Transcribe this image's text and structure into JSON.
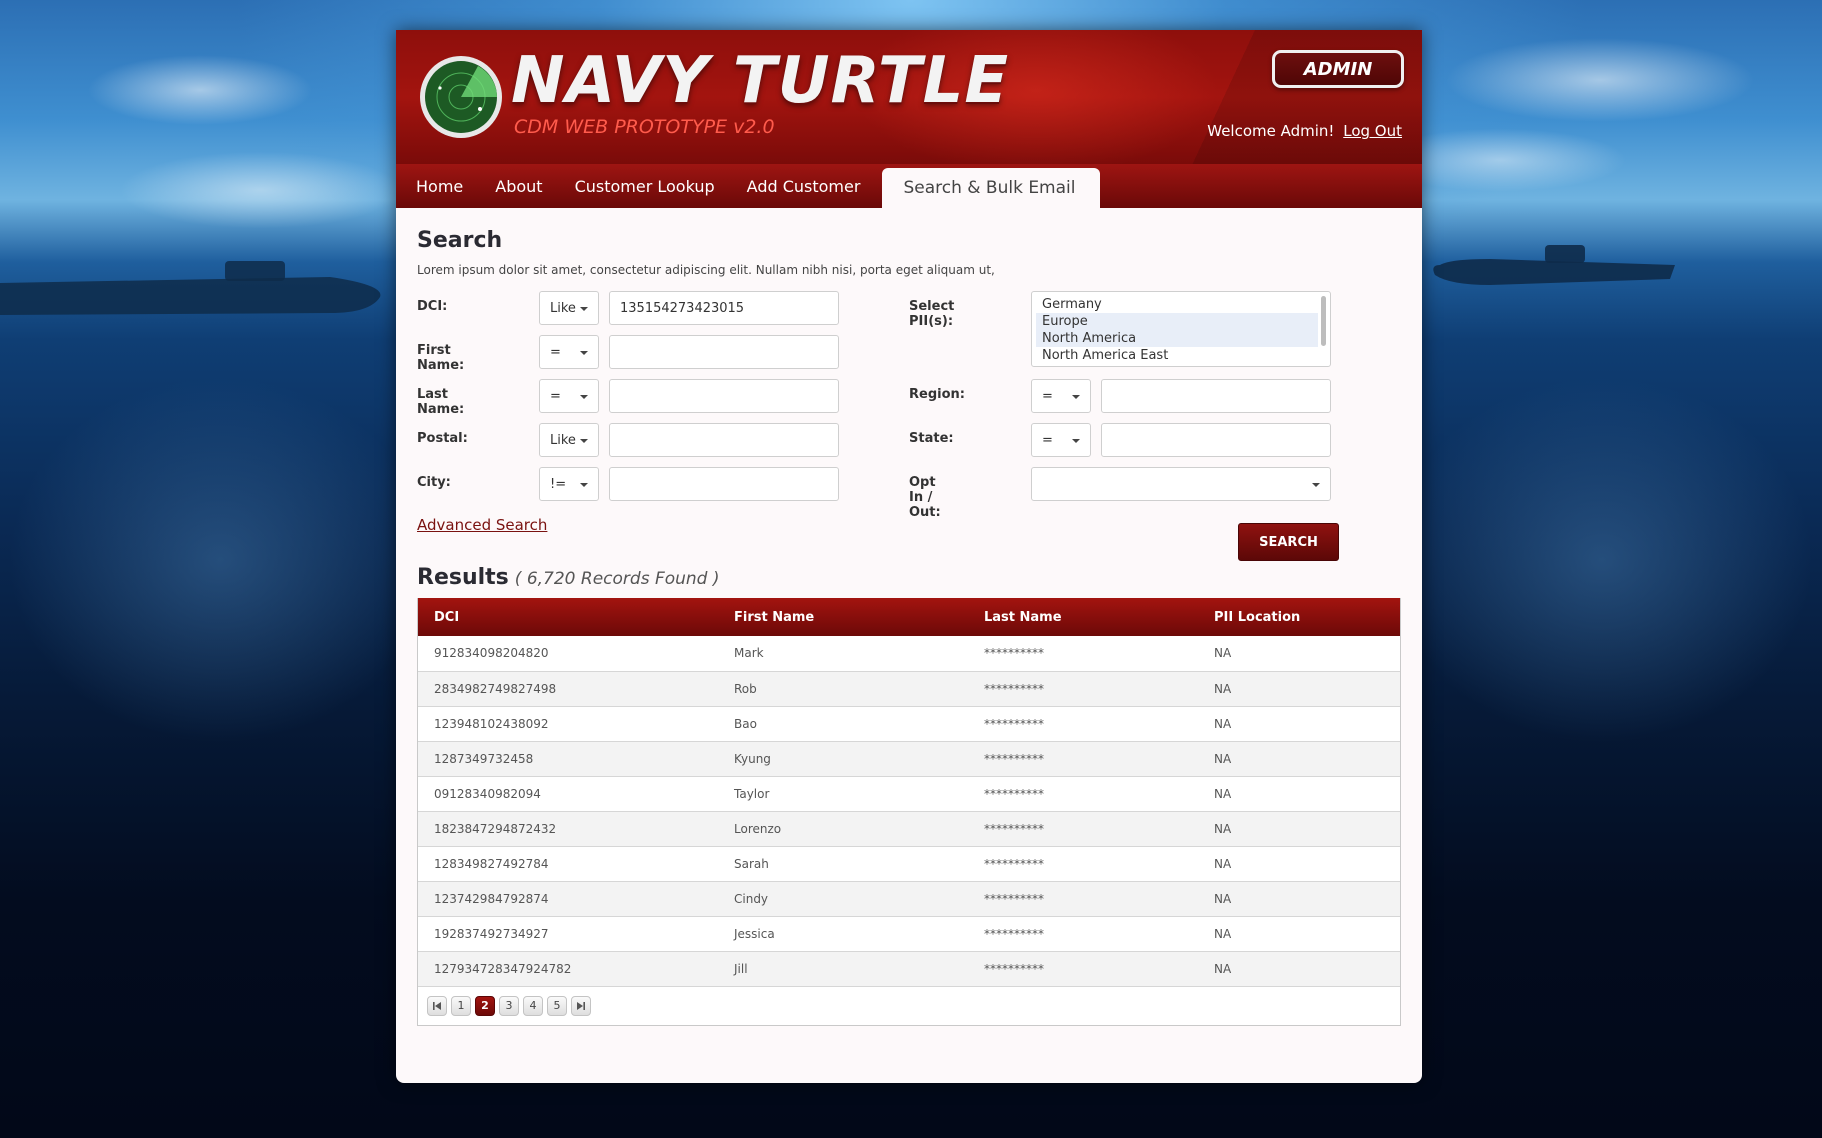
{
  "app": {
    "title": "NAVY TURTLE",
    "subtitle": "CDM WEB PROTOTYPE v2.0",
    "role_badge": "ADMIN",
    "welcome": "Welcome Admin!",
    "logout": "Log Out"
  },
  "nav": {
    "items": [
      {
        "label": "Home"
      },
      {
        "label": "About"
      },
      {
        "label": "Customer Lookup"
      },
      {
        "label": "Add Customer"
      },
      {
        "label": "Search & Bulk Email"
      }
    ],
    "active_index": 4
  },
  "search": {
    "title": "Search",
    "description": "Lorem ipsum dolor sit amet, consectetur adipiscing elit. Nullam nibh nisi, porta eget aliquam ut,",
    "fields": {
      "dci": {
        "label": "DCI:",
        "operator": "Like",
        "value": "135154273423015"
      },
      "first_name": {
        "label": "First Name:",
        "operator": "=",
        "value": ""
      },
      "last_name": {
        "label": "Last Name:",
        "operator": "=",
        "value": ""
      },
      "postal": {
        "label": "Postal:",
        "operator": "Like",
        "value": ""
      },
      "city": {
        "label": "City:",
        "operator": "!=",
        "value": ""
      },
      "pii": {
        "label": "Select PII(s):",
        "options": [
          "Germany",
          "Europe",
          "North America",
          "North America East"
        ],
        "selected": [
          "Europe",
          "North America"
        ]
      },
      "region": {
        "label": "Region:",
        "operator": "=",
        "value": ""
      },
      "state": {
        "label": "State:",
        "operator": "=",
        "value": ""
      },
      "opt_in_out": {
        "label": "Opt In / Out:",
        "value": ""
      }
    },
    "advanced_link": "Advanced Search",
    "button": "SEARCH"
  },
  "results": {
    "title": "Results",
    "count_text": "( 6,720 Records Found )",
    "columns": [
      "DCI",
      "First Name",
      "Last Name",
      "PII Location"
    ],
    "rows": [
      [
        "912834098204820",
        "Mark",
        "**********",
        "NA"
      ],
      [
        "2834982749827498",
        "Rob",
        "**********",
        "NA"
      ],
      [
        "123948102438092",
        "Bao",
        "**********",
        "NA"
      ],
      [
        "1287349732458",
        "Kyung",
        "**********",
        "NA"
      ],
      [
        "09128340982094",
        "Taylor",
        "**********",
        "NA"
      ],
      [
        "1823847294872432",
        "Lorenzo",
        "**********",
        "NA"
      ],
      [
        "128349827492784",
        "Sarah",
        "**********",
        "NA"
      ],
      [
        "123742984792874",
        "Cindy",
        "**********",
        "NA"
      ],
      [
        "192837492734927",
        "Jessica",
        "**********",
        "NA"
      ],
      [
        "127934728347924782",
        "Jill",
        "**********",
        "NA"
      ]
    ],
    "pager": {
      "pages": [
        "1",
        "2",
        "3",
        "4",
        "5"
      ],
      "current": "2"
    }
  }
}
